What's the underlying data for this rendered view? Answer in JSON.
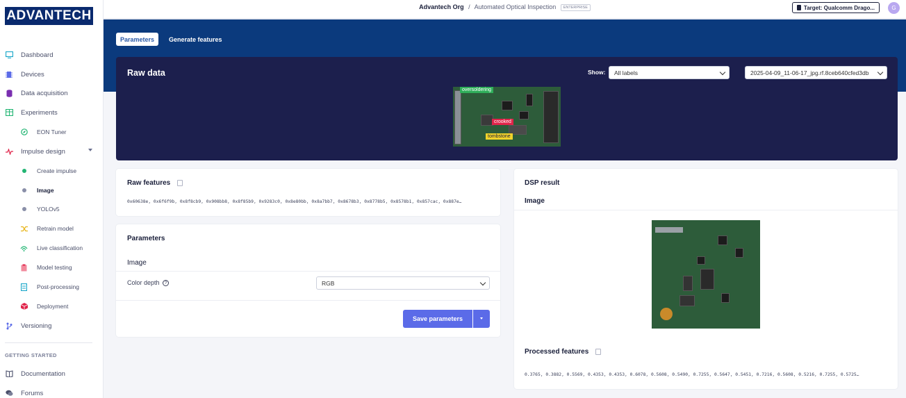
{
  "logo": {
    "text": "ADVANTECH"
  },
  "sidebar": {
    "items": [
      {
        "label": "Dashboard",
        "icon": "monitor-icon"
      },
      {
        "label": "Devices",
        "icon": "chip-icon"
      },
      {
        "label": "Data acquisition",
        "icon": "database-icon"
      },
      {
        "label": "Experiments",
        "icon": "table-icon"
      },
      {
        "label": "EON Tuner",
        "icon": "compass-icon"
      },
      {
        "label": "Impulse design",
        "icon": "pulse-icon"
      },
      {
        "label": "Create impulse",
        "icon": "dot-icon"
      },
      {
        "label": "Image",
        "icon": "dot-icon"
      },
      {
        "label": "YOLOv5",
        "icon": "dot-icon"
      },
      {
        "label": "Retrain model",
        "icon": "shuffle-icon"
      },
      {
        "label": "Live classification",
        "icon": "signal-icon"
      },
      {
        "label": "Model testing",
        "icon": "clipboard-icon"
      },
      {
        "label": "Post-processing",
        "icon": "document-icon"
      },
      {
        "label": "Deployment",
        "icon": "package-icon"
      },
      {
        "label": "Versioning",
        "icon": "branch-icon"
      }
    ],
    "section_label": "GETTING STARTED",
    "footer_items": [
      {
        "label": "Documentation",
        "icon": "book-icon"
      },
      {
        "label": "Forums",
        "icon": "chat-icon"
      }
    ]
  },
  "topbar": {
    "org": "Advantech Org",
    "separator": "/",
    "project": "Automated Optical Inspection",
    "badge": "ENTERPRISE",
    "target": "Target: Qualcomm Drago...",
    "avatar": "G"
  },
  "tabs": {
    "parameters": "Parameters",
    "generate": "Generate features"
  },
  "raw_data": {
    "title": "Raw data",
    "show_label": "Show:",
    "show_value": "All labels",
    "sample_value": "2025-04-09_11-06-17_jpg.rf.8ceb640cfed3db",
    "labels": {
      "a": "oversoldering",
      "b": "crooked",
      "c": "tombstone"
    }
  },
  "raw_features": {
    "title": "Raw features",
    "values": "0x60638e, 0x6f6f9b, 0x8f8cb9, 0x908bb8, 0x8f85b9, 0x9283c0, 0x8e80bb, 0x8a7bb7, 0x8678b3, 0x8778b5, 0x8578b1, 0x857cac, 0x887e…"
  },
  "parameters": {
    "title": "Parameters",
    "section": "Image",
    "color_depth_label": "Color depth",
    "help": "?",
    "color_depth_value": "RGB",
    "save_label": "Save parameters"
  },
  "dsp": {
    "title": "DSP result",
    "section": "Image",
    "processed_title": "Processed features",
    "processed_values": "0.3765, 0.3882, 0.5569, 0.4353, 0.4353, 0.6078, 0.5608, 0.5490, 0.7255, 0.5647, 0.5451, 0.7216, 0.5608, 0.5216, 0.7255, 0.5725…"
  },
  "colors": {
    "band": "#0b3a7d",
    "raw_card": "#1c1f4d",
    "accent": "#5b6be8",
    "tag_oversoldering": "#2fae5a",
    "tag_crooked": "#e0244a",
    "tag_tombstone": "#f2d22b"
  }
}
